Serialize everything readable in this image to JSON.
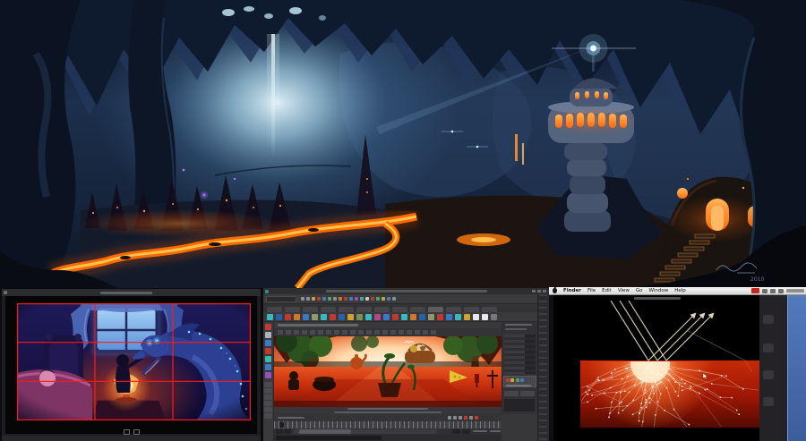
{
  "artwork": {
    "name": "cave-city-concept-painting",
    "signature_year": "2010",
    "palette": {
      "cave_blue": "#22385c",
      "glow_blue": "#bfe8f5",
      "lava_orange": "#ff6a00",
      "window_orange": "#ff8c2e"
    }
  },
  "viewer": {
    "name": "image-viewer-with-thirds-grid",
    "grid_color": "#ff1a1a",
    "toolbar_icons": [
      "cursor-icon",
      "pages-icon"
    ]
  },
  "maya": {
    "name": "autodesk-maya-window",
    "toolbox_icon_colors": [
      "#c23a30",
      "#aab2ba",
      "#3a7ac8",
      "#c23a30",
      "#3ab8b0",
      "#3a7ac8",
      "#9a50b8"
    ],
    "status_icon_colors": [
      "#8a9098",
      "#8a9098",
      "#c8a040",
      "#b04030",
      "#4878c0",
      "#48a868",
      "#8a9098",
      "#c87830",
      "#b04030",
      "#4878c0",
      "#9850a8",
      "#48a8a8",
      "#c8c8c8",
      "#b04030",
      "#48a868",
      "#c8a040",
      "#4878c0",
      "#8a9098"
    ],
    "shelf_icon_colors": [
      "#38b8c0",
      "#2860a8",
      "#c03830",
      "#d07828",
      "#3878c8",
      "#909870",
      "#38b8c0",
      "#c03830",
      "#2860a8",
      "#d0a030",
      "#789058",
      "#38b8c0",
      "#b04890",
      "#3878c8",
      "#c03830",
      "#38b8c0",
      "#d07828",
      "#2860a8",
      "#909870",
      "#c03830",
      "#3878c8",
      "#38b8c0",
      "#d0a030",
      "#e8e8e8",
      "#e8e8e8",
      "#787878"
    ],
    "shelf_tab_count": 13,
    "mini_panel_dot_colors": [
      "#c43a32",
      "#d0a23a",
      "#4aa44a",
      "#3a7ac8"
    ],
    "transport_colors": [
      "#8a8a8e",
      "#8a8a8e",
      "#8a8a8e",
      "#c23a30",
      "#8a8a8e",
      "#c23a30"
    ]
  },
  "mac": {
    "name": "mac-desktop-screenshot",
    "menu_items": [
      "Finder",
      "File",
      "Edit",
      "View",
      "Go",
      "Window",
      "Help"
    ],
    "desktop_blue": "#4a6fb5",
    "slide": {
      "name": "subsurface-scattering-diagram",
      "background": "#000000",
      "surface_top_color": "#c62a08",
      "surface_bottom_color": "#520a02",
      "ray_color": "#efe6cc"
    }
  }
}
